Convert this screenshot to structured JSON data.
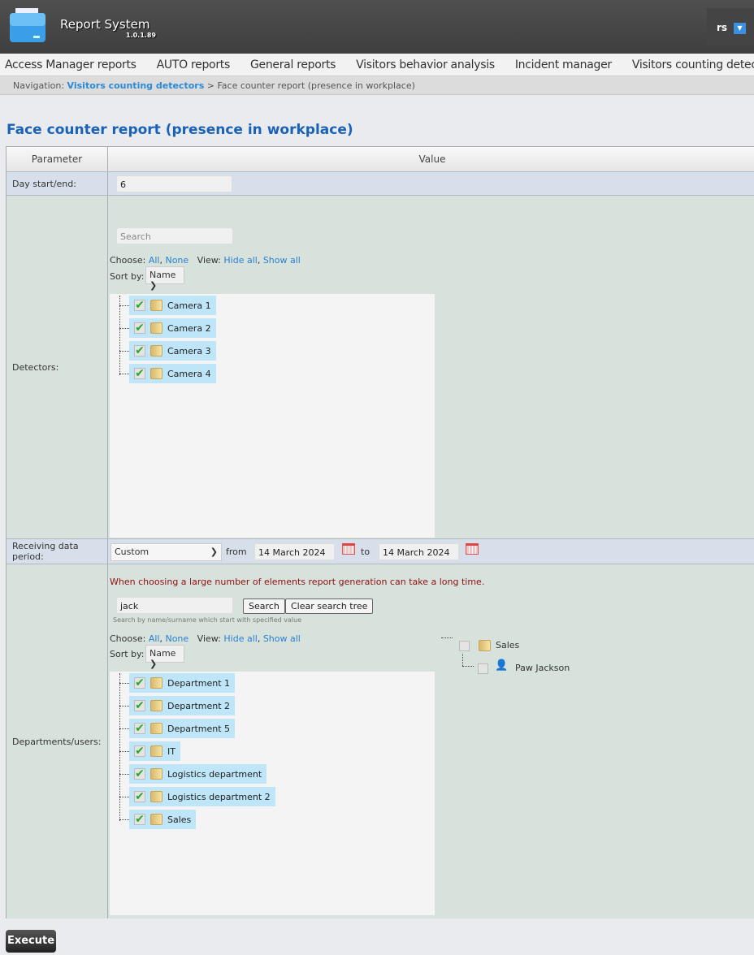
{
  "header": {
    "app_title": "Report System",
    "version": "1.0.1.89",
    "user": "rs"
  },
  "menu": [
    "Access Manager reports",
    "AUTO reports",
    "General reports",
    "Visitors behavior analysis",
    "Incident manager",
    "Visitors counting detectors"
  ],
  "breadcrumb": {
    "label": "Navigation:",
    "link": "Visitors counting detectors",
    "separator": ">",
    "current": "Face counter report (presence in workplace)"
  },
  "page_title": "Face counter report (presence in workplace)",
  "table": {
    "col_param": "Parameter",
    "col_value": "Value"
  },
  "day": {
    "label": "Day start/end:",
    "value": "6"
  },
  "detectors": {
    "label": "Detectors:",
    "search_placeholder": "Search",
    "choose": "Choose:",
    "all": "All",
    "none": "None",
    "view": "View:",
    "hide_all": "Hide all",
    "show_all": "Show all",
    "sort_by": "Sort by:",
    "sort_value": "Name",
    "items": [
      "Camera 1",
      "Camera 2",
      "Camera 3",
      "Camera 4"
    ]
  },
  "period": {
    "label": "Receiving data period:",
    "type": "Custom",
    "from_label": "from",
    "from": "14 March 2024",
    "to_label": "to",
    "to": "14 March 2024"
  },
  "departments": {
    "label": "Departments/users:",
    "warning": "When choosing a large number of elements report generation can take a long time.",
    "search_value": "jack",
    "search_button": "Search",
    "clear_button": "Clear search tree",
    "hint": "Search by name/surname which start with specified value",
    "choose": "Choose:",
    "all": "All",
    "none": "None",
    "view": "View:",
    "hide_all": "Hide all",
    "show_all": "Show all",
    "sort_by": "Sort by:",
    "sort_value": "Name",
    "items": [
      "Department 1",
      "Department 2",
      "Department 5",
      "IT",
      "Logistics department",
      "Logistics department 2",
      "Sales"
    ],
    "search_results": {
      "group": "Sales",
      "user": "Paw Jackson"
    }
  },
  "execute": "Execute"
}
